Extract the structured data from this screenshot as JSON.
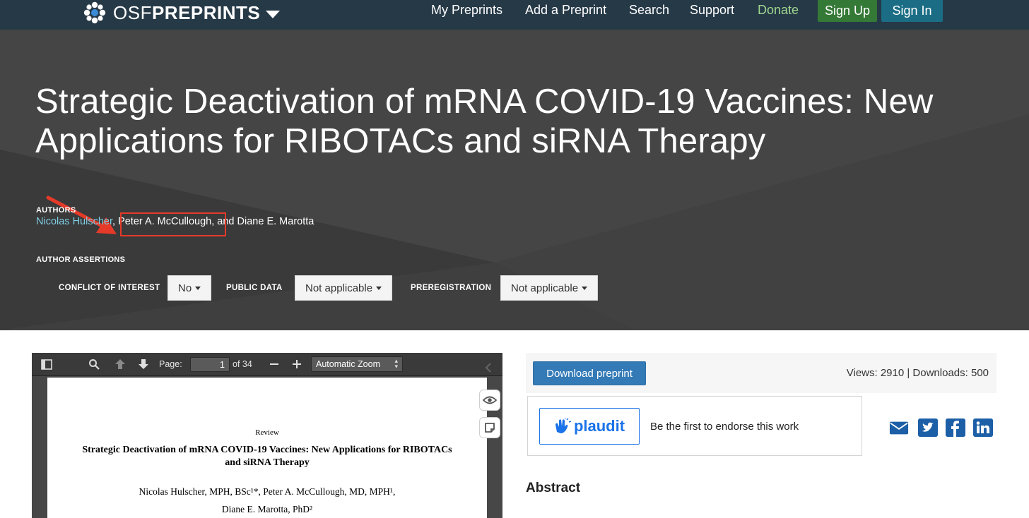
{
  "navbar": {
    "brand_osf": "OSF",
    "brand_preprints": "PREPRINTS",
    "links": [
      "My Preprints",
      "Add a Preprint",
      "Search",
      "Support",
      "Donate"
    ],
    "signup_label": "Sign Up",
    "signin_label": "Sign In"
  },
  "header": {
    "title": "Strategic Deactivation of mRNA COVID-19 Vaccines: New Applications for RIBOTACs and siRNA Therapy",
    "authors_label": "AUTHORS",
    "authors": [
      "Nicolas Hulscher",
      "Peter A. McCullough",
      "Diane E. Marotta"
    ],
    "author_sep1": ", ",
    "author_sep2": ", and ",
    "assertions_label": "AUTHOR ASSERTIONS",
    "coi_label": "CONFLICT OF INTEREST",
    "coi_value": "No",
    "public_data_label": "PUBLIC DATA",
    "public_data_value": "Not applicable",
    "prereg_label": "PREREGISTRATION",
    "prereg_value": "Not applicable"
  },
  "pdf_viewer": {
    "page_label": "Page:",
    "page_value": "1",
    "page_total": "of 34",
    "zoom": "Automatic Zoom",
    "page": {
      "review": "Review",
      "title": "Strategic Deactivation of mRNA COVID-19 Vaccines: New Applications for RIBOTACs and siRNA Therapy",
      "authors_line1": "Nicolas Hulscher, MPH, BSc¹*, Peter A. McCullough, MD, MPH¹,",
      "authors_line2": "Diane E. Marotta, PhD²"
    }
  },
  "sidebar": {
    "download_label": "Download preprint",
    "stats": "Views: 2910 | Downloads: 500",
    "plaudit_logo": "plaudit",
    "plaudit_text": "Be the first to endorse this work",
    "share_icons": [
      "email-icon",
      "twitter-icon",
      "facebook-icon",
      "linkedin-icon"
    ]
  },
  "abstract_heading": "Abstract",
  "colors": {
    "navbar": "#263947",
    "header": "#3f3f3f",
    "author_link": "#7ecde3",
    "donate": "#9fd68e",
    "signup": "#357936",
    "signin": "#1b6d85",
    "primary_button": "#337ab7",
    "annotation_red": "#e53a29"
  }
}
